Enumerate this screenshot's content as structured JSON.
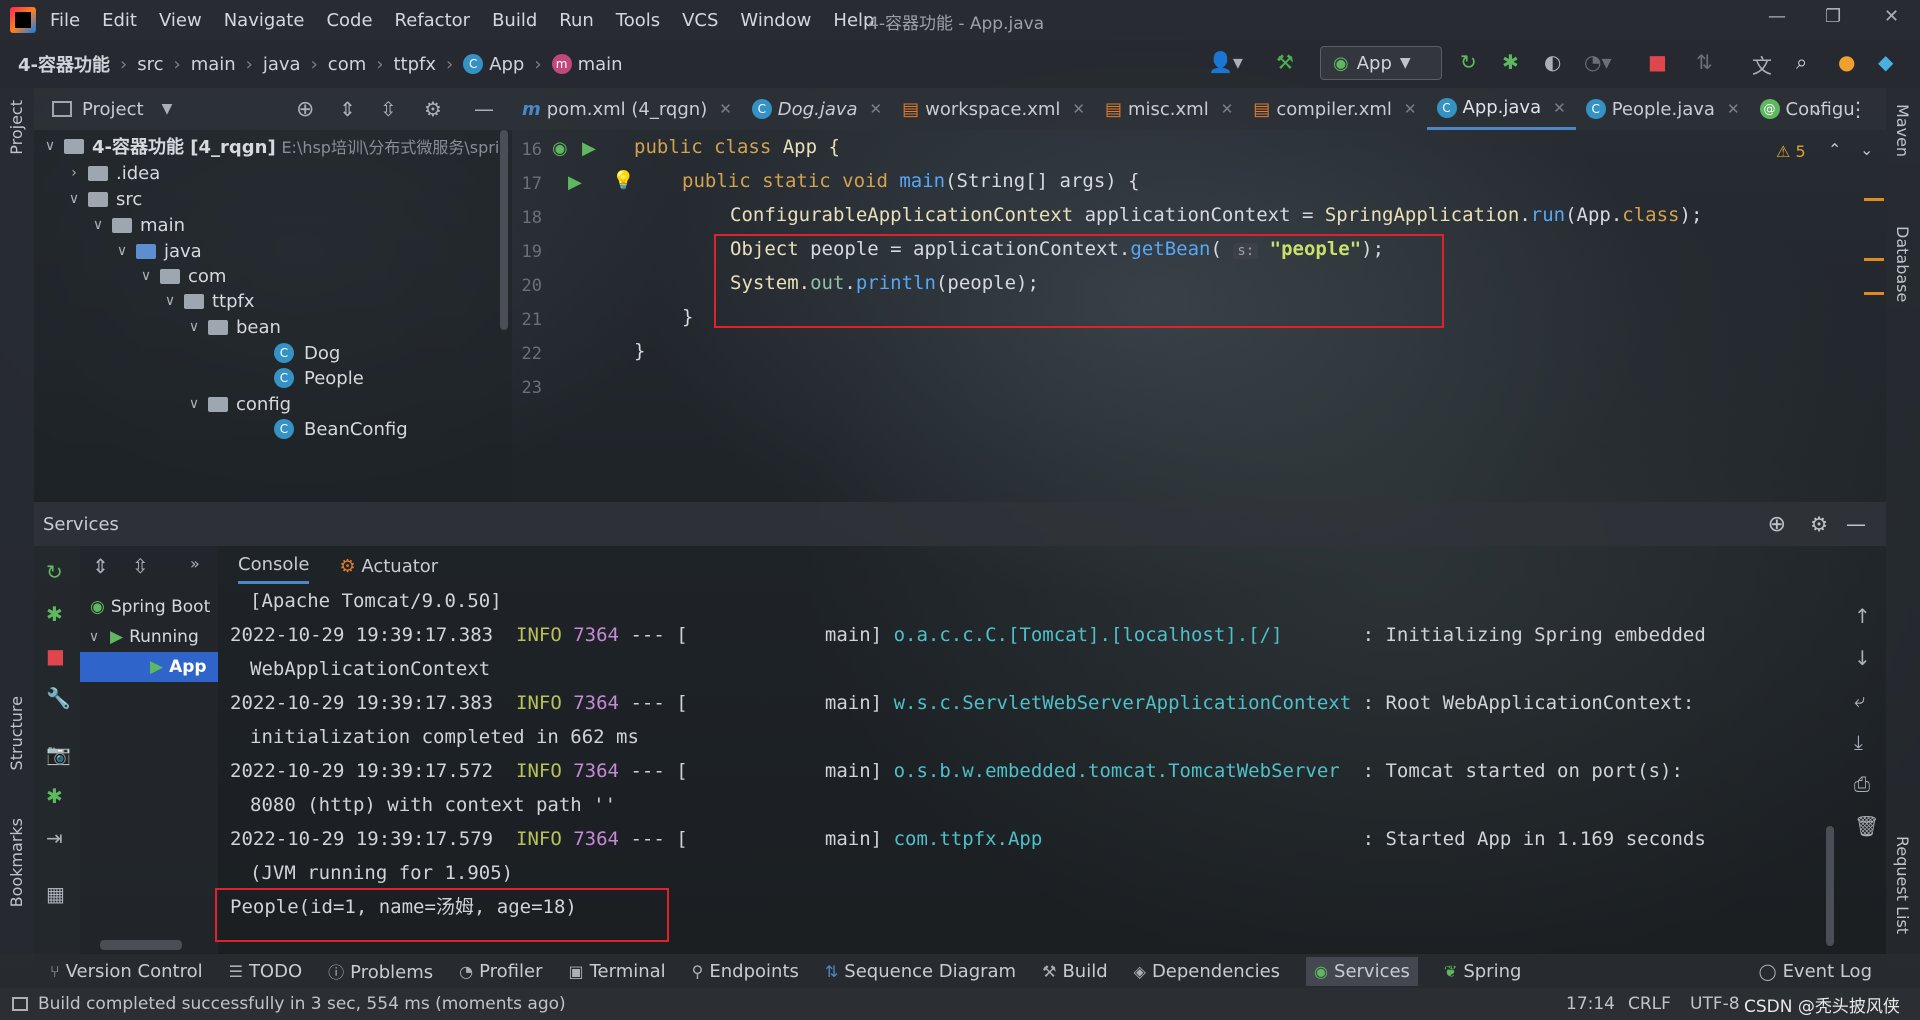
{
  "window": {
    "title": "4-容器功能 - App.java"
  },
  "menu": [
    "File",
    "Edit",
    "View",
    "Navigate",
    "Code",
    "Refactor",
    "Build",
    "Run",
    "Tools",
    "VCS",
    "Window",
    "Help"
  ],
  "breadcrumb": [
    "4-容器功能",
    "src",
    "main",
    "java",
    "com",
    "ttpfx",
    "App",
    "main"
  ],
  "run_config": "App",
  "side_left": {
    "project": "Project",
    "structure": "Structure",
    "bookmarks": "Bookmarks"
  },
  "side_right": {
    "maven": "Maven",
    "database": "Database",
    "request_list": "Request List"
  },
  "project_panel": {
    "title": "Project",
    "root": "4-容器功能 [4_rqgn]",
    "root_path": "E:\\hsp培训\\分布式微服务\\sprin",
    "nodes": [
      ".idea",
      "src",
      "main",
      "java",
      "com",
      "ttpfx",
      "bean",
      "Dog",
      "People",
      "config",
      "BeanConfig"
    ]
  },
  "editor_tabs": [
    "pom.xml (4_rqgn)",
    "Dog.java",
    "workspace.xml",
    "misc.xml",
    "compiler.xml",
    "App.java",
    "People.java",
    "Configu"
  ],
  "warnings": "5",
  "line_numbers": [
    "16",
    "17",
    "18",
    "19",
    "20",
    "21",
    "22",
    "23"
  ],
  "code": {
    "l16_kw": "public class",
    "l16_name": " App {",
    "l17_kw": "public static void",
    "l17_fn": " main",
    "l17_rest": "(String[] args) {",
    "l18_type": "ConfigurableApplicationContext",
    "l18_mid": " applicationContext = ",
    "l18_cls": "SpringApplication",
    "l18_dot": ".",
    "l18_fn": "run",
    "l18_rest1": "(App.",
    "l18_kw": "class",
    "l18_rest2": ");",
    "l19_type": "Object",
    "l19_mid": " people = applicationContext.",
    "l19_fn": "getBean",
    "l19_open": "( ",
    "l19_hint": "s:",
    "l19_str": " \"people\"",
    "l19_close": ");",
    "l20_a": "System.",
    "l20_fld": "out",
    "l20_dot": ".",
    "l20_fn": "println",
    "l20_rest": "(people);",
    "l21": "}",
    "l22": "}"
  },
  "services": {
    "title": "Services",
    "tabs": [
      "Console",
      "Actuator"
    ],
    "tree": [
      "Spring Boot",
      "Running",
      "App"
    ],
    "console": [
      {
        "text": "[Apache Tomcat/9.0.50]"
      },
      {
        "ts": "2022-10-29 19:39:17.383",
        "level": "INFO",
        "pid": "7364",
        "sep": "--- [",
        "thread": "main]",
        "logger": "o.a.c.c.C.[Tomcat].[localhost].[/]",
        "msg": ": Initializing Spring embedded"
      },
      {
        "text": "WebApplicationContext"
      },
      {
        "ts": "2022-10-29 19:39:17.383",
        "level": "INFO",
        "pid": "7364",
        "sep": "--- [",
        "thread": "main]",
        "logger": "w.s.c.ServletWebServerApplicationContext",
        "msg": ": Root WebApplicationContext:"
      },
      {
        "text": "initialization completed in 662 ms"
      },
      {
        "ts": "2022-10-29 19:39:17.572",
        "level": "INFO",
        "pid": "7364",
        "sep": "--- [",
        "thread": "main]",
        "logger": "o.s.b.w.embedded.tomcat.TomcatWebServer",
        "msg": ": Tomcat started on port(s):"
      },
      {
        "text": "8080 (http) with context path ''"
      },
      {
        "ts": "2022-10-29 19:39:17.579",
        "level": "INFO",
        "pid": "7364",
        "sep": "--- [",
        "thread": "main]",
        "logger": "com.ttpfx.App",
        "msg": ": Started App in 1.169 seconds"
      },
      {
        "text": "(JVM running for 1.905)"
      },
      {
        "text": "People(id=1, name=汤姆, age=18)"
      }
    ]
  },
  "bottom_tools": [
    "Version Control",
    "TODO",
    "Problems",
    "Profiler",
    "Terminal",
    "Endpoints",
    "Sequence Diagram",
    "Build",
    "Dependencies",
    "Services",
    "Spring",
    "Event Log"
  ],
  "status": {
    "message": "Build completed successfully in 3 sec, 554 ms (moments ago)",
    "position": "17:14",
    "line_sep": "CRLF",
    "encoding": "UTF-8",
    "watermark": "CSDN @秃头披风侠"
  }
}
